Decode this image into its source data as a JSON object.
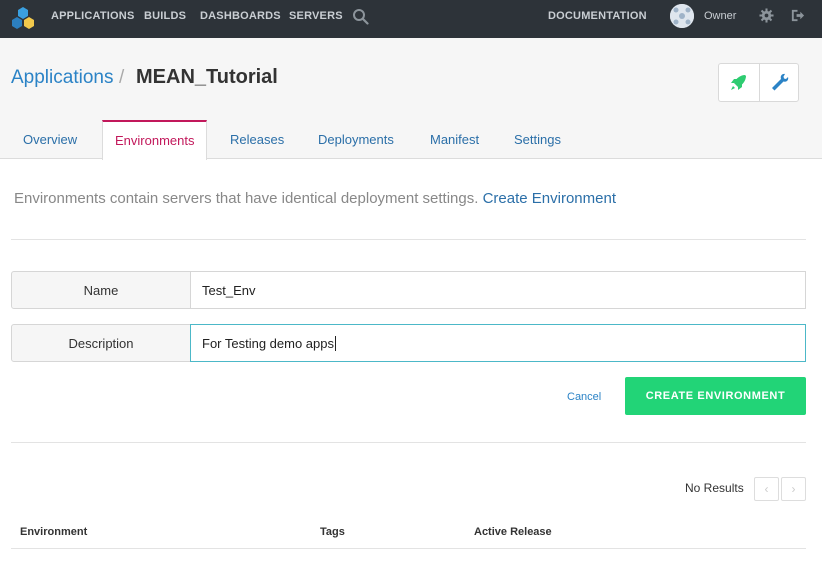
{
  "nav": {
    "items": [
      {
        "label": "APPLICATIONS"
      },
      {
        "label": "BUILDS"
      },
      {
        "label": "DASHBOARDS"
      },
      {
        "label": "SERVERS"
      }
    ],
    "documentation": "DOCUMENTATION",
    "user": "Owner"
  },
  "breadcrumb": {
    "parent": "Applications",
    "separator": "/",
    "current": "MEAN_Tutorial"
  },
  "tabs": [
    {
      "label": "Overview"
    },
    {
      "label": "Environments",
      "active": true
    },
    {
      "label": "Releases"
    },
    {
      "label": "Deployments"
    },
    {
      "label": "Manifest"
    },
    {
      "label": "Settings"
    }
  ],
  "intro": {
    "text": "Environments contain servers that have identical deployment settings.",
    "link": "Create Environment"
  },
  "form": {
    "name_label": "Name",
    "name_value": "Test_Env",
    "description_label": "Description",
    "description_value": "For Testing demo apps",
    "cancel": "Cancel",
    "submit": "CREATE ENVIRONMENT"
  },
  "table": {
    "status": "No Results",
    "prev": "‹",
    "next": "›",
    "columns": [
      "Environment",
      "Tags",
      "Active Release"
    ]
  },
  "colors": {
    "nav_bg": "#2d3339",
    "link": "#2b83c6",
    "active_tab": "#c2185b",
    "primary_button": "#22d477",
    "accent_green": "#2ecc71"
  }
}
